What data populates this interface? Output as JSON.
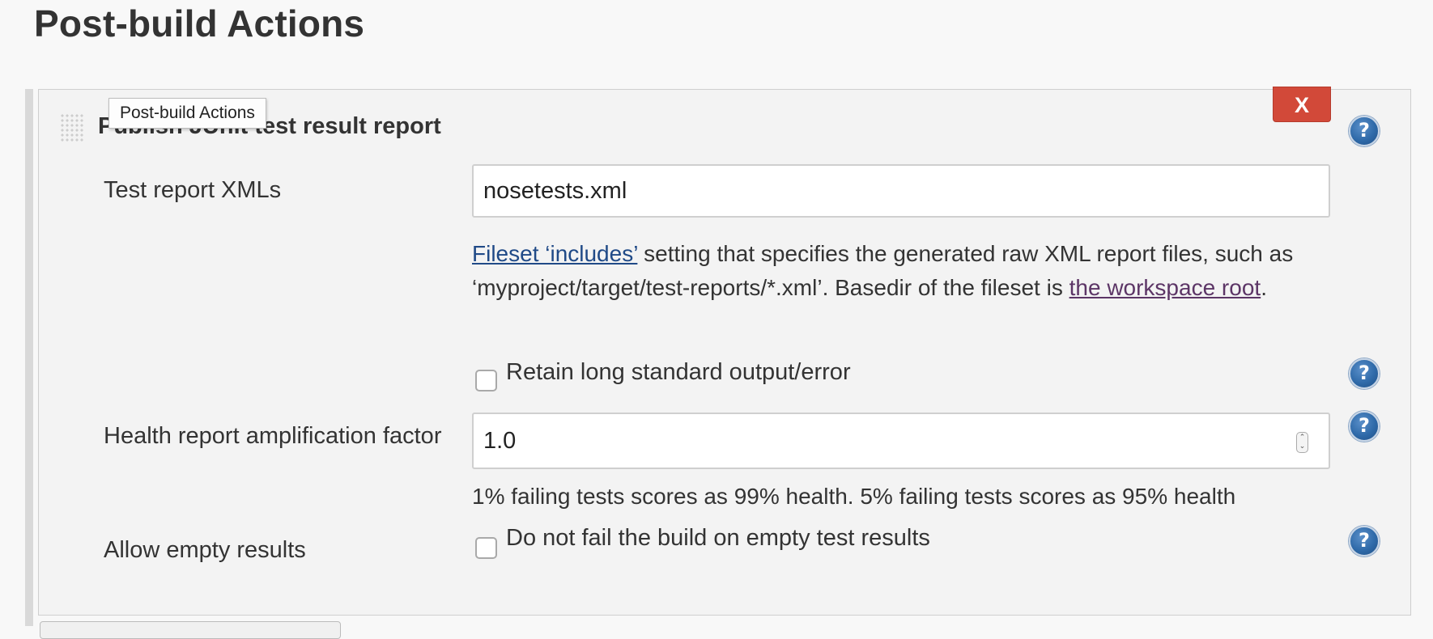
{
  "section": {
    "title": "Post-build Actions"
  },
  "tooltip": {
    "text": "Post-build Actions"
  },
  "step": {
    "title": "Publish JUnit test result report",
    "delete_label": "X",
    "help_label": "?"
  },
  "test_report": {
    "label": "Test report XMLs",
    "value": "nosetests.xml",
    "desc": {
      "link1": "Fileset ‘includes’",
      "text1": " setting that specifies the generated raw XML report files, such as ‘myproject/target/test-reports/*.xml’. Basedir of the fileset is ",
      "link2": "the workspace root",
      "text2": "."
    }
  },
  "retain": {
    "label": "Retain long standard output/error",
    "checked": false
  },
  "health": {
    "label": "Health report amplification factor",
    "value": "1.0",
    "spinner_up": "⌃",
    "spinner_down": "⌄",
    "desc": "1% failing tests scores as 99% health. 5% failing tests scores as 95% health"
  },
  "allow_empty": {
    "label": "Allow empty results",
    "checkbox_label": "Do not fail the build on empty test results",
    "checked": false
  },
  "colors": {
    "delete_button": "#d24939",
    "help_icon": "#2f6aa9",
    "link": "#204a87",
    "visited_link": "#5c3566",
    "background": "#f8f8f8",
    "panel": "#f3f3f3"
  }
}
